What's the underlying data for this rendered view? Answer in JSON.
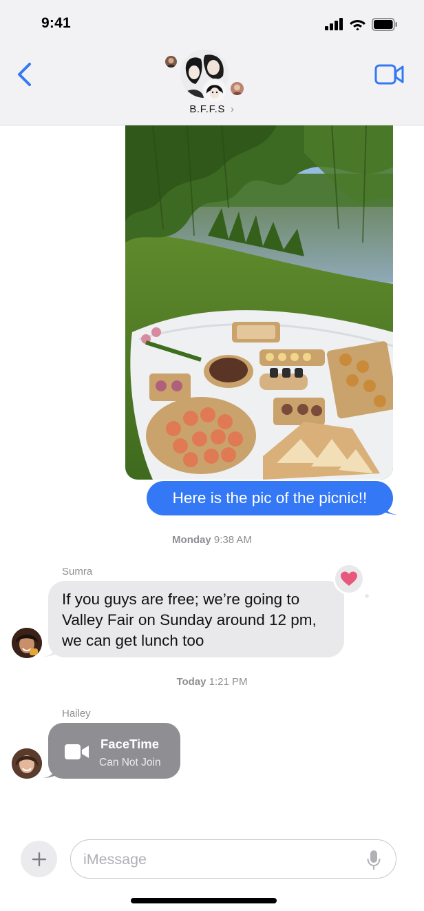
{
  "status_bar": {
    "time": "9:41"
  },
  "header": {
    "group_name": "B.F.F.S",
    "chevron": "›"
  },
  "messages": {
    "outgoing": {
      "text": "Here is the pic of the picnic!!"
    },
    "timestamp_1": {
      "day": "Monday",
      "time": "9:38 AM"
    },
    "sumra": {
      "sender": "Sumra",
      "text": "If you guys are free; we’re going to Valley Fair on Sunday around 12 pm, we can get lunch too",
      "reaction": "heart-icon"
    },
    "timestamp_2": {
      "day": "Today",
      "time": "1:21 PM"
    },
    "hailey": {
      "sender": "Hailey",
      "facetime_title": "FaceTime",
      "facetime_status": "Can Not Join"
    }
  },
  "input": {
    "placeholder": "iMessage"
  },
  "colors": {
    "accent": "#3478f6",
    "incoming_bubble": "#e9e9eb",
    "facetime_bubble": "#8e8e93",
    "reaction_heart": "#e8587c"
  }
}
